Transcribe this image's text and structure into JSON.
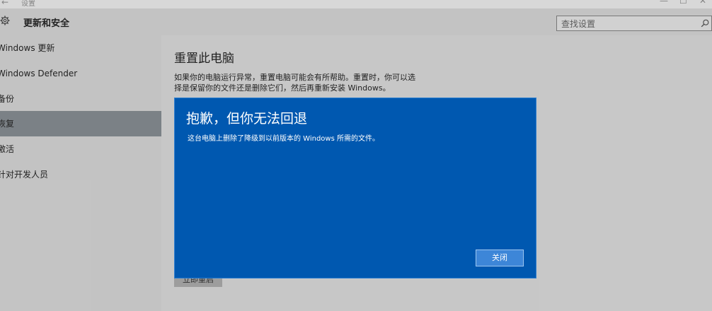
{
  "window": {
    "title": "设置",
    "back_glyph": "←",
    "minimize_glyph": "—",
    "maximize_glyph": "☐",
    "close_glyph": "✕"
  },
  "header": {
    "title": "更新和安全",
    "icon": "gear-icon"
  },
  "search": {
    "placeholder": "查找设置",
    "icon": "search-icon"
  },
  "sidebar": {
    "items": [
      {
        "label": "Windows 更新",
        "active": false
      },
      {
        "label": "Windows Defender",
        "active": false
      },
      {
        "label": "备份",
        "active": false
      },
      {
        "label": "恢复",
        "active": true
      },
      {
        "label": "激活",
        "active": false
      },
      {
        "label": "针对开发人员",
        "active": false
      }
    ]
  },
  "main": {
    "title": "重置此电脑",
    "description": "如果你的电脑运行异常，重置电脑可能会有所帮助。重置时，你可以选择是保留你的文件还是删除它们，然后再重新安装 Windows。",
    "start_button_label": "立即重启"
  },
  "dialog": {
    "title": "抱歉，但你无法回退",
    "message": "这台电脑上删除了降级到以前版本的 Windows 所需的文件。",
    "close_label": "关闭"
  },
  "colors": {
    "dialog_bg": "#0058b0",
    "dialog_button": "#3d86d8",
    "sidebar_active": "#8e959b",
    "page_bg": "#e6e6e6"
  }
}
